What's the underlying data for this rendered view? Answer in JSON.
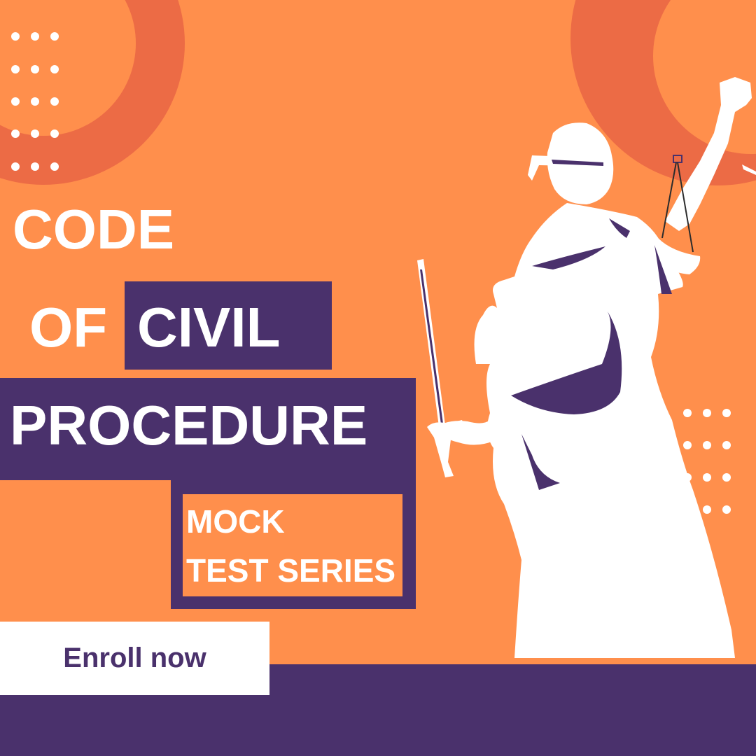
{
  "poster": {
    "title_line1": "CODE",
    "title_line2_a": "OF",
    "title_line2_b": "CIVIL",
    "title_line3": "PROCEDURE",
    "subtitle_line1": "MOCK",
    "subtitle_line2": "TEST SERIES",
    "cta_label": "Enroll now",
    "illustration": "lady-justice-silhouette",
    "colors": {
      "background": "#ff8f4c",
      "accent_ring": "#ec6b45",
      "purple": "#4a316c",
      "text": "#ffffff"
    }
  }
}
